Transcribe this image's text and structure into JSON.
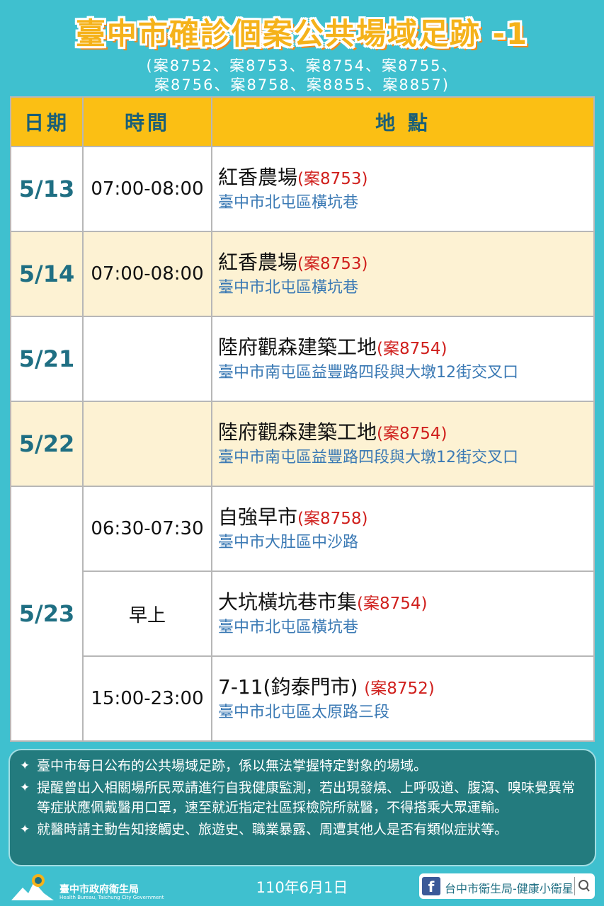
{
  "header": {
    "title": "臺中市確診個案公共場域足跡 -1",
    "cases_line1": "(案8752、案8753、案8754、案8755、",
    "cases_line2": "案8756、案8758、案8855、案8857)"
  },
  "table": {
    "headers": [
      "日期",
      "時間",
      "地 點"
    ],
    "rows": [
      {
        "date": "5/13",
        "time": "07:00-08:00",
        "place": "紅香農場",
        "case": "(案8753)",
        "address": "臺中市北屯區橫坑巷"
      },
      {
        "date": "5/14",
        "time": "07:00-08:00",
        "place": "紅香農場",
        "case": "(案8753)",
        "address": "臺中市北屯區橫坑巷"
      },
      {
        "date": "5/21",
        "time": "",
        "place": "陸府觀森建築工地",
        "case": "(案8754)",
        "address": "臺中市南屯區益豐路四段與大墩12街交叉口"
      },
      {
        "date": "5/22",
        "time": "",
        "place": "陸府觀森建築工地",
        "case": "(案8754)",
        "address": "臺中市南屯區益豐路四段與大墩12街交叉口"
      },
      {
        "date": "5/23",
        "time": "06:30-07:30",
        "place": "自強早市",
        "case": "(案8758)",
        "address": "臺中市大肚區中沙路"
      },
      {
        "date": "",
        "time": "早上",
        "place": "大坑橫坑巷市集",
        "case": "(案8754)",
        "address": "臺中市北屯區橫坑巷"
      },
      {
        "date": "",
        "time": "15:00-23:00",
        "place": "7-11(鈞泰門市) ",
        "case": "(案8752)",
        "address": "臺中市北屯區太原路三段"
      }
    ]
  },
  "notes": [
    "臺中市每日公布的公共場域足跡，係以無法掌握特定對象的場域。",
    "提醒曾出入相關場所民眾請進行自我健康監測，若出現發燒、上呼吸道、腹瀉、嗅味覺異常等症狀應佩戴醫用口罩，速至就近指定社區採檢院所就醫，不得搭乘大眾運輸。",
    "就醫時請主動告知接觸史、旅遊史、職業暴露、周遭其他人是否有類似症狀等。"
  ],
  "footer": {
    "org_name": "臺中市政府衛生局",
    "org_en": "Health Bureau, Taichung City Government",
    "issued_date": "110年6月1日",
    "fb_label": "台中市衛生局-健康小衛星",
    "fb_icon": "facebook-icon",
    "search_icon": "search-icon"
  },
  "colors": {
    "background": "#3fc0cf",
    "header_yellow": "#fbbf14",
    "title_yellow": "#f5b21a",
    "case_red": "#d0201d",
    "address_blue": "#3a79b4",
    "date_teal": "#1f6f83",
    "notes_bg": "#237b7e",
    "alt_row": "#fdf2d3"
  }
}
